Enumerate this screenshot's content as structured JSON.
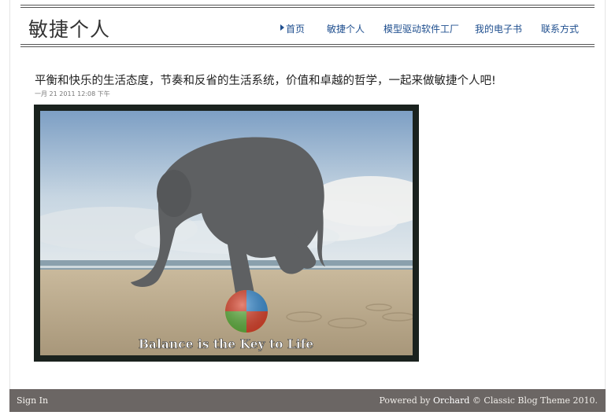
{
  "site": {
    "title": "敏捷个人"
  },
  "nav": {
    "items": [
      {
        "label": "首页"
      },
      {
        "label": "敏捷个人"
      },
      {
        "label": "模型驱动软件工厂"
      },
      {
        "label": "我的电子书"
      },
      {
        "label": "联系方式"
      }
    ]
  },
  "post": {
    "title": "平衡和快乐的生活态度，节奏和反省的生活系统，价值和卓越的哲学，一起来做敏捷个人吧!",
    "date": "一月 21 2011 12:08 下午",
    "image_caption": "Balance is the Key to Life"
  },
  "footer": {
    "sign_in": "Sign In",
    "powered_by": "Powered by",
    "brand": "Orchard",
    "theme_text": "© Classic Blog Theme 2010."
  },
  "colors": {
    "nav_link": "#1f4f8f",
    "footer_bg": "#6b6664"
  }
}
